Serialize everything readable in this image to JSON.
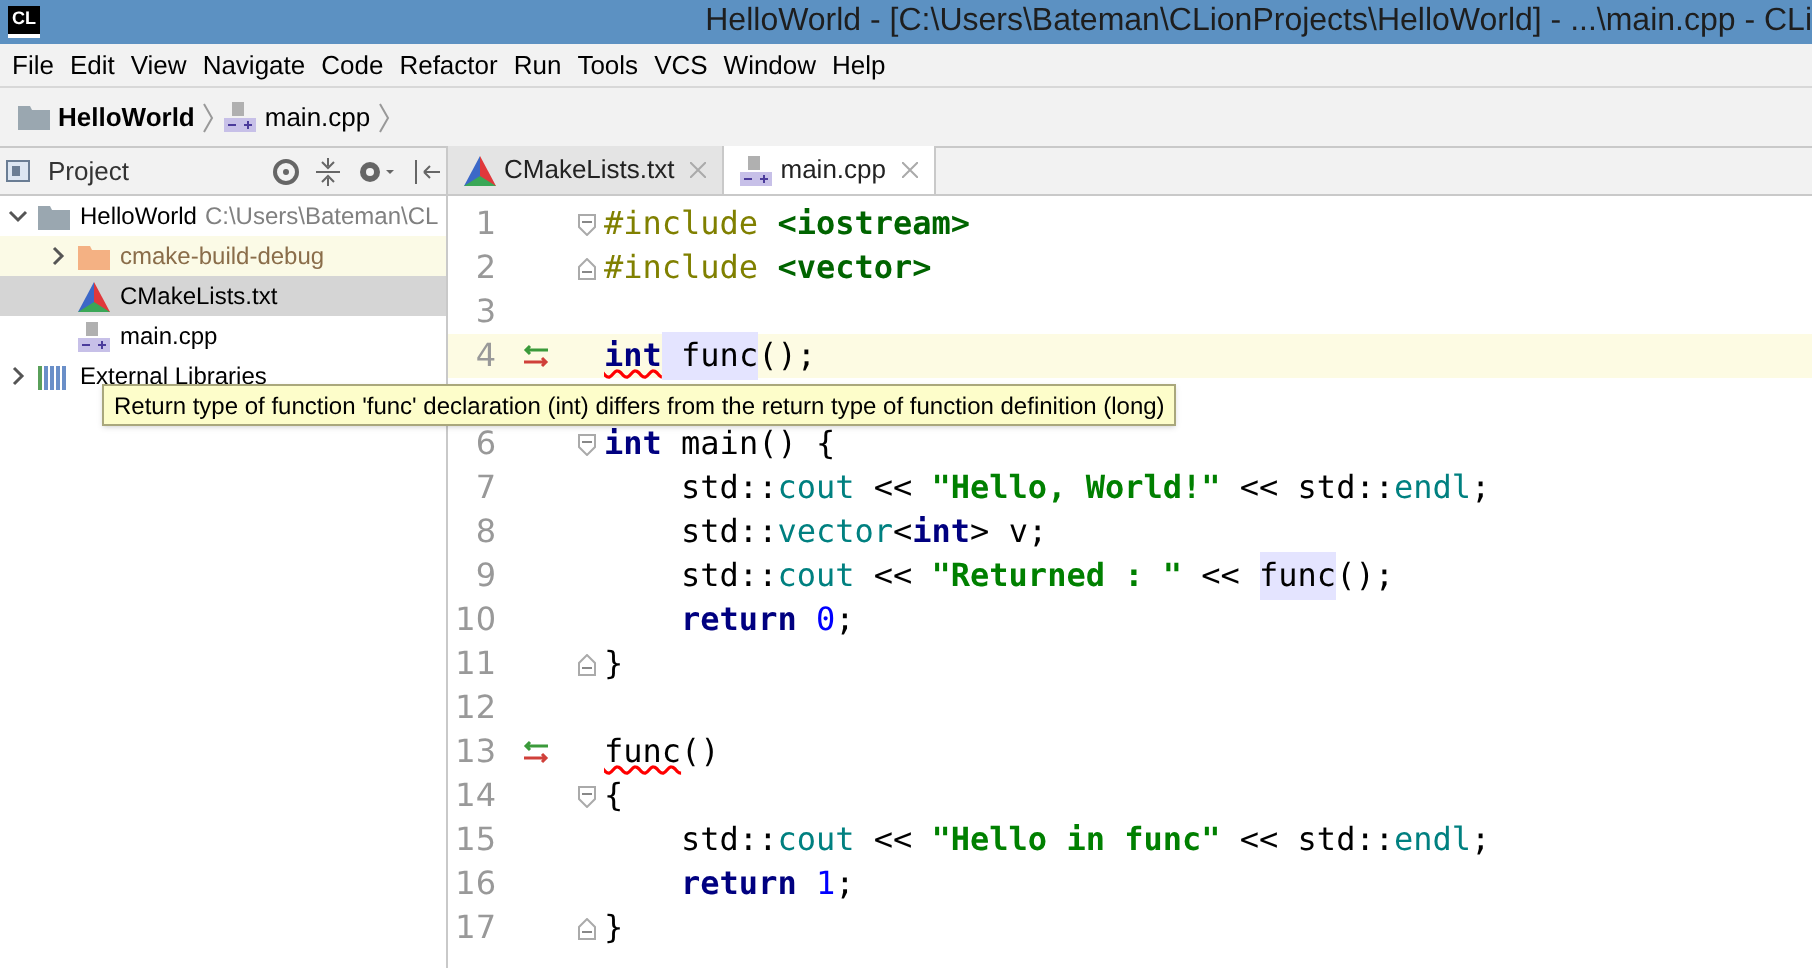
{
  "window": {
    "title": "HelloWorld - [C:\\Users\\Bateman\\CLionProjects\\HelloWorld] - ...\\main.cpp - CLi",
    "logo": "CL"
  },
  "menu": [
    "File",
    "Edit",
    "View",
    "Navigate",
    "Code",
    "Refactor",
    "Run",
    "Tools",
    "VCS",
    "Window",
    "Help"
  ],
  "breadcrumb": [
    {
      "label": "HelloWorld",
      "kind": "folder"
    },
    {
      "label": "main.cpp",
      "kind": "cpp"
    }
  ],
  "project_panel": {
    "title": "Project"
  },
  "tree": [
    {
      "label": "HelloWorld",
      "path": "C:\\Users\\Bateman\\CL",
      "kind": "folder",
      "expanded": true,
      "selected": false,
      "children": [
        {
          "label": "cmake-build-debug",
          "kind": "excluded",
          "expanded": false,
          "selected": false
        },
        {
          "label": "CMakeLists.txt",
          "kind": "cmake",
          "selected": true
        },
        {
          "label": "main.cpp",
          "kind": "cpp",
          "selected": false
        }
      ]
    },
    {
      "label": "External Libraries",
      "kind": "libraries",
      "expanded": false,
      "selected": false
    }
  ],
  "tabs": [
    {
      "label": "CMakeLists.txt",
      "kind": "cmake",
      "selected": false
    },
    {
      "label": "main.cpp",
      "kind": "cpp",
      "selected": true
    }
  ],
  "editor": {
    "lines": [
      {
        "number": "1",
        "fold_start": true,
        "tokens": [
          {
            "t": "#include ",
            "kind": "dir"
          },
          {
            "t": "<iostream>",
            "kind": "inc"
          }
        ]
      },
      {
        "number": "2",
        "fold_end": true,
        "tokens": [
          {
            "t": "#include ",
            "kind": "dir"
          },
          {
            "t": "<vector>",
            "kind": "inc"
          }
        ]
      },
      {
        "number": "3"
      },
      {
        "number": "4",
        "current": true,
        "conflict": true,
        "tokens": [
          {
            "t": "int",
            "kind": "kwerr"
          },
          {
            "t": " func",
            "kind": "hl"
          },
          {
            "t": "();",
            "kind": "plain"
          }
        ],
        "tooltip": "Return type of function 'func' declaration (int) differs from the return type of function definition (long)"
      },
      {
        "number": "6",
        "fold_start": true,
        "tokens": [
          {
            "t": "int",
            "kind": "kw"
          },
          {
            "t": " main() {",
            "kind": "plain"
          }
        ]
      },
      {
        "number": "7",
        "tokens": [
          {
            "t": "    std::",
            "kind": "plain"
          },
          {
            "t": "cout",
            "kind": "ns"
          },
          {
            "t": " << ",
            "kind": "plain"
          },
          {
            "t": "\"Hello, World!\"",
            "kind": "str"
          },
          {
            "t": " << std::",
            "kind": "plain"
          },
          {
            "t": "endl",
            "kind": "ns"
          },
          {
            "t": ";",
            "kind": "plain"
          }
        ]
      },
      {
        "number": "8",
        "tokens": [
          {
            "t": "    std::",
            "kind": "plain"
          },
          {
            "t": "vector",
            "kind": "ns"
          },
          {
            "t": "<",
            "kind": "plain"
          },
          {
            "t": "int",
            "kind": "kw"
          },
          {
            "t": "> v;",
            "kind": "plain"
          }
        ]
      },
      {
        "number": "9",
        "tokens": [
          {
            "t": "    std::",
            "kind": "plain"
          },
          {
            "t": "cout",
            "kind": "ns"
          },
          {
            "t": " << ",
            "kind": "plain"
          },
          {
            "t": "\"Returned : \"",
            "kind": "str"
          },
          {
            "t": " << ",
            "kind": "plain"
          },
          {
            "t": "func",
            "kind": "hl"
          },
          {
            "t": "();",
            "kind": "plain"
          }
        ]
      },
      {
        "number": "10",
        "tokens": [
          {
            "t": "    return",
            "kind": "kw"
          },
          {
            "t": " 0",
            "kind": "num"
          },
          {
            "t": ";",
            "kind": "plain"
          }
        ]
      },
      {
        "number": "11",
        "fold_end": true,
        "tokens": [
          {
            "t": "}",
            "kind": "plain"
          }
        ]
      },
      {
        "number": "12"
      },
      {
        "number": "13",
        "conflict": true,
        "tokens": [
          {
            "t": "func",
            "kind": "err"
          },
          {
            "t": "()",
            "kind": "plain"
          }
        ]
      },
      {
        "number": "14",
        "fold_start": true,
        "tokens": [
          {
            "t": "{",
            "kind": "plain"
          }
        ]
      },
      {
        "number": "15",
        "tokens": [
          {
            "t": "    std::",
            "kind": "plain"
          },
          {
            "t": "cout",
            "kind": "ns"
          },
          {
            "t": " << ",
            "kind": "plain"
          },
          {
            "t": "\"Hello in func\"",
            "kind": "str"
          },
          {
            "t": " << std::",
            "kind": "plain"
          },
          {
            "t": "endl",
            "kind": "ns"
          },
          {
            "t": ";",
            "kind": "plain"
          }
        ]
      },
      {
        "number": "16",
        "tokens": [
          {
            "t": "    return",
            "kind": "kw"
          },
          {
            "t": " 1",
            "kind": "num"
          },
          {
            "t": ";",
            "kind": "plain"
          }
        ]
      },
      {
        "number": "17",
        "fold_end": true,
        "tokens": [
          {
            "t": "}",
            "kind": "plain"
          }
        ]
      }
    ]
  }
}
